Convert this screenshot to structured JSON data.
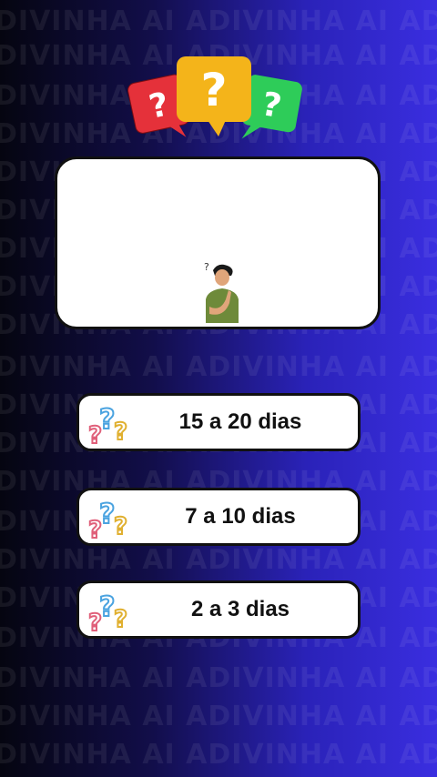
{
  "background": {
    "watermark_text": "DIVINHA AI ADIVINHA AI ADIVINHA AI ADIVINHA AI ADIVINHA",
    "colors": {
      "left": "#050510",
      "mid": "#120e4a",
      "right": "#3a2ee0"
    }
  },
  "logo": {
    "icon": "three-question-speech-bubbles-icon",
    "colors": {
      "red": "#e5313a",
      "yellow": "#f4b41a",
      "green": "#2ecc59"
    }
  },
  "question_card": {
    "image": "thinking-man-illustration"
  },
  "answers": [
    {
      "label": "15 a 20 dias",
      "icon": "question-marks-icon"
    },
    {
      "label": "7 a 10 dias",
      "icon": "question-marks-icon"
    },
    {
      "label": "2 a 3 dias",
      "icon": "question-marks-icon"
    }
  ]
}
